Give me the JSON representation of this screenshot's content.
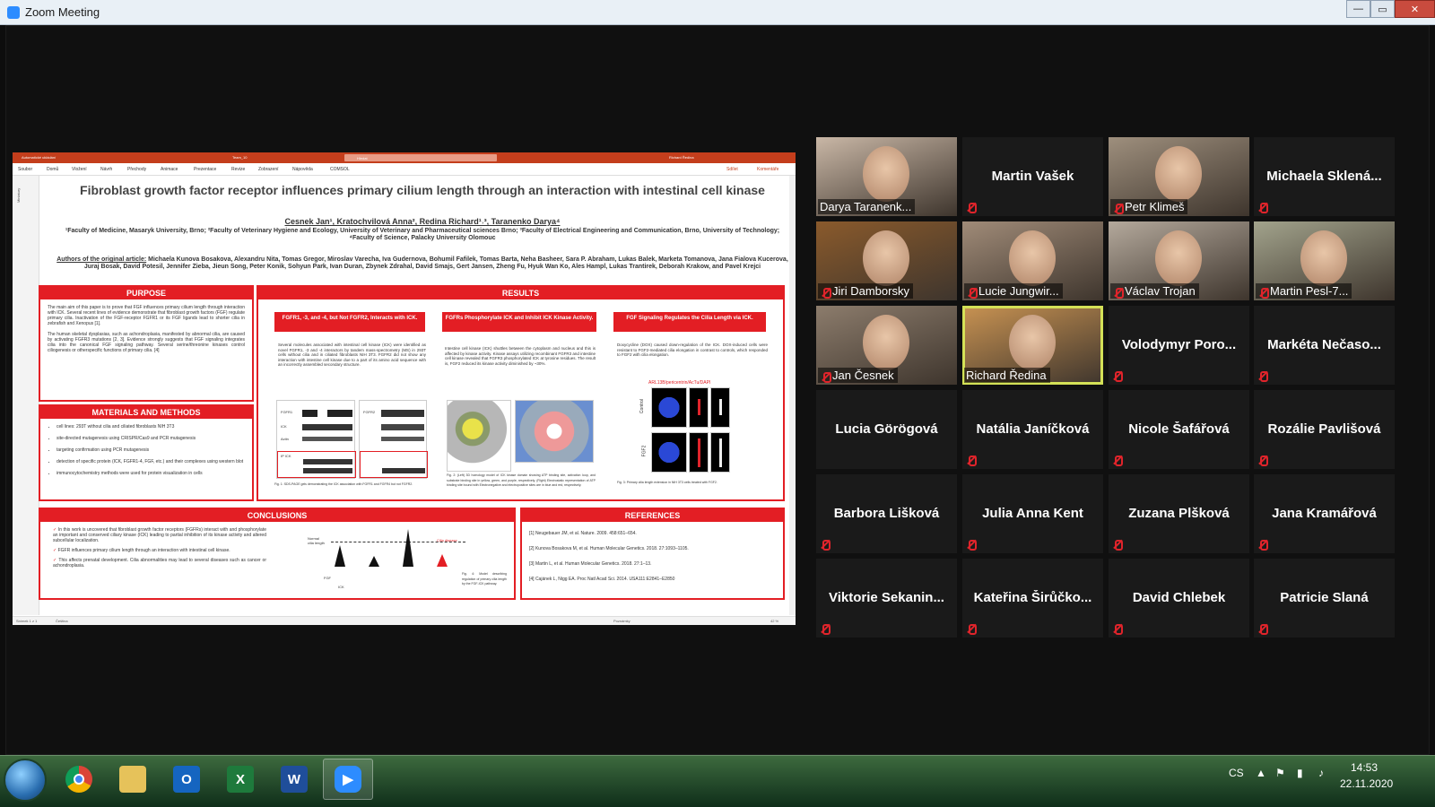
{
  "window": {
    "title": "Zoom Meeting",
    "controls": [
      "—",
      "▭",
      "✕"
    ]
  },
  "powerpoint": {
    "autosave": "Automatické ukládání",
    "doc_title": "Team_10",
    "search_placeholder": "Hledat",
    "user": "Richard Ředina",
    "menu": [
      "Soubor",
      "Domů",
      "Vložení",
      "Návrh",
      "Přechody",
      "Animace",
      "Prezentace",
      "Revize",
      "Zobrazení",
      "Nápověda",
      "COMSOL"
    ],
    "share_btn": "Sdílet",
    "comments_btn": "Komentáře",
    "left_pane": "Miniatury",
    "status_slide": "Snímek 1 z 1",
    "status_lang": "Čeština",
    "notes": "Poznámky",
    "zoom": "42 %"
  },
  "poster": {
    "title": "Fibroblast growth factor receptor influences primary cilium length through an interaction with intestinal cell kinase",
    "authors": "Cesnek Jan¹, Kratochvilová Anna², Redina Richard¹˒³, Taranenko Darya⁴",
    "affiliations": "¹Faculty of Medicine, Masaryk University, Brno; ²Faculty of Veterinary Hygiene and Ecology, University of Veterinary and Pharmaceutical sciences Brno; ³Faculty of Electrical Engineering and Communication, Brno, University of Technology; ⁴Faculty of Science, Palacky University Olomouc",
    "original_authors_label": "Authors of the original article:",
    "original_authors": "Michaela Kunova Bosakova, Alexandru Nita, Tomas Gregor, Miroslav Varecha, Iva Gudernova, Bohumil Fafilek, Tomas Barta, Neha Basheer, Sara P. Abraham, Lukas Balek, Marketa Tomanova, Jana Fialova Kucerova, Juraj Bosak, David Potesil, Jennifer Zieba, Jieun Song, Peter Konik, Sohyun Park, Ivan Duran, Zbynek Zdrahal, David Smajs, Gert Jansen, Zheng Fu, Hyuk Wan Ko, Ales Hampl, Lukas Trantirek, Deborah Krakow, and Pavel Krejci",
    "purpose": {
      "header": "PURPOSE",
      "p1": "The main aim of this paper is to prove that FGF influences primary cilium length through interaction with ICK. Several recent lines of evidence demonstrate that fibroblast growth factors (FGF) regulate primary cilia. Inactivation of the FGF-receptor FGFR1 or its FGF ligands lead to shorter cilia in zebrafish and Xenopus [1].",
      "p2": "The human skeletal dysplasias, such as achondroplasia, manifested by abnormal cilia, are caused by activating FGFR3 mutations [2, 3]. Evidence strongly suggests that FGF signaling integrates cilia into the canonical FGF signaling pathway. Several serine/threonine kinases control ciliogenesis or otherspecific functions of primary cilia. [4]"
    },
    "methods": {
      "header": "MATERIALS AND METHODS",
      "items": [
        "cell lines: 293T without cilia and ciliated fibroblasts NIH 3T3",
        "site-directed mutagenesis using CRISPR/Cas9 and PCR mutagenesis",
        "targeting confirmation using PCR mutagenesis",
        "detection of specific protein (ICK, FGFR1-4, FGF, etc.) and their complexes using western blot",
        "immunocytochemistry methods were used for protein visualization in cells"
      ]
    },
    "results": {
      "header": "RESULTS",
      "cols": [
        {
          "title": "FGFR1, -3, and -4, but Not FGFR2, Interacts with ICK.",
          "text": "Several molecules associated with intestinal cell kinase (ICK) were identified as novel FGFR1, -3 and -4 interactors by tandem mass-spectrometry (MS) in 293T cells without cilia and in ciliated fibroblasts NIH 3T3. FGFR2 did not show any interaction with intestine cell kinase due to a part of its amino acid sequence with an incorrectly assembled secondary structure.",
          "caption": "Fig. 1: SDS-PAGE gels demonstrating the ICK association with FGFR1 and FGFR4 but not FGFR2."
        },
        {
          "title": "FGFRs Phosphorylate ICK and Inhibit ICK Kinase Activity.",
          "text": "Intestine cell kinase (ICK) shuttles between the cytoplasm and nucleus and this is affected by kinase activity. Kinase assays utilizing recombinant FGFR3 and intestine cell kinase revealed that FGFR3 phosphorylated ICK at tyrosine residues. The result is, FGF2 reduced its kinase activity diminished by ~30%.",
          "caption": "Fig. 2: (Left) 3D homology model of ICK kinase domain showing ATP binding site, activation loop, and substrate binding site in yellow, green, and purple, respectively. (Right) Electrostatic representation of ATP binding site bound with Electronegative and electropositive sites are in blue and red, respectively."
        },
        {
          "title": "FGF Signaling Regulates the Cilia Length via ICK.",
          "text": "Doxycycline (DOX) caused down-regulation of the ICK. DOX-induced cells were resistant to FGF2-mediated cilia elongation in contrast to controls, which responded to FGF2 with cilia elongation.",
          "caption": "Fig. 3: Primary cilia length extension in NIH 3T3 cells treated with FGF2.",
          "stain": "ARL13B/pericentrin/AcTu/DAPI",
          "rows": [
            "Control",
            "FGF2"
          ]
        }
      ],
      "blot_labels": [
        "FGFR1",
        "FGFR4",
        "ICK",
        "Actin",
        "FGFR2",
        "IP ICK",
        "Lysate"
      ]
    },
    "conclusions": {
      "header": "CONCLUSIONS",
      "items": [
        "In this work is uncovered that fibroblast growth factor receptors (FGFRs) interact with and phosphorylate an important and conserved ciliary kinase (ICK) leading to partial inhibition of its kinase activity and altered subcellular localization.",
        "FGFR influences primary cilium length through an interaction with intestinal cell kinase.",
        "This affects prenatal development. Cilia abnormalities may lead to several diseases such as cancer or achondroplasia."
      ],
      "diagram_labels": [
        "Normal cilia length",
        "Cilia disease",
        "FGF",
        "ICK"
      ],
      "caption": "Fig. 4: Model describing regulation of primary cilia length by the FGF-ICK pathway."
    },
    "references": {
      "header": "REFERENCES",
      "items": [
        "[1] Neugebauer JM, et al. Nature. 2009. 458:651–654.",
        "[2] Kunova Bosakova M, et al. Human Molecular Genetics. 2018. 27:1093–1105.",
        "[3] Martin L, et al. Human Molecular Genetics. 2018. 27:1–13.",
        "[4] Cajánek L, Nigg EA. Proc Natl Acad Sci. 2014. USA111:E2841–E2850"
      ]
    }
  },
  "participants": [
    {
      "name": "Darya Taranenk...",
      "video": true,
      "muted": false,
      "tone": "#c9b7a6"
    },
    {
      "name": "Martin Vašek",
      "video": false,
      "muted": true
    },
    {
      "name": "Petr Klimeš",
      "video": true,
      "muted": true,
      "tone": "#9e8f7d"
    },
    {
      "name": "Michaela  Sklená...",
      "video": false,
      "muted": true
    },
    {
      "name": "Jiri Damborsky",
      "video": true,
      "muted": true,
      "tone": "#8a5a2c"
    },
    {
      "name": "Lucie Jungwir...",
      "video": true,
      "muted": true,
      "tone": "#a08b78"
    },
    {
      "name": "Václav Trojan",
      "video": true,
      "muted": true,
      "tone": "#b4a99c"
    },
    {
      "name": "Martin Pesl-7...",
      "video": true,
      "muted": true,
      "tone": "#a2a38c"
    },
    {
      "name": "Jan Česnek",
      "video": true,
      "muted": true,
      "tone": "#8c7c6c"
    },
    {
      "name": "Richard Ředina",
      "video": true,
      "muted": false,
      "tone": "#c99352",
      "active": true
    },
    {
      "name": "Volodymyr  Poro...",
      "video": false,
      "muted": true
    },
    {
      "name": "Markéta  Nečaso...",
      "video": false,
      "muted": true
    },
    {
      "name": "Lucia Görögová",
      "video": false,
      "muted": false
    },
    {
      "name": "Natália Janíčková",
      "video": false,
      "muted": true
    },
    {
      "name": "Nicole Šafářová",
      "video": false,
      "muted": true
    },
    {
      "name": "Rozálie Pavlišová",
      "video": false,
      "muted": true
    },
    {
      "name": "Barbora Lišková",
      "video": false,
      "muted": true
    },
    {
      "name": "Julia Anna Kent",
      "video": false,
      "muted": true
    },
    {
      "name": "Zuzana Plšková",
      "video": false,
      "muted": true
    },
    {
      "name": "Jana Kramářová",
      "video": false,
      "muted": true
    },
    {
      "name": "Viktorie  Sekanin...",
      "video": false,
      "muted": true
    },
    {
      "name": "Kateřina  Širůčko...",
      "video": false,
      "muted": true
    },
    {
      "name": "David Chlebek",
      "video": false,
      "muted": true
    },
    {
      "name": "Patricie Slaná",
      "video": false,
      "muted": true
    }
  ],
  "taskbar": {
    "apps": [
      {
        "name": "chrome-icon",
        "label": "",
        "color": "#e8b030"
      },
      {
        "name": "file-explorer-icon",
        "label": "",
        "color": "#e6c25a"
      },
      {
        "name": "outlook-icon",
        "label": "O",
        "color": "#1565c0"
      },
      {
        "name": "excel-icon",
        "label": "X",
        "color": "#1e7a3c"
      },
      {
        "name": "word-icon",
        "label": "W",
        "color": "#1f4e9a"
      },
      {
        "name": "zoom-icon",
        "label": "▶",
        "color": "#2d8cff"
      }
    ],
    "lang": "CS",
    "time": "14:53",
    "date": "22.11.2020"
  }
}
